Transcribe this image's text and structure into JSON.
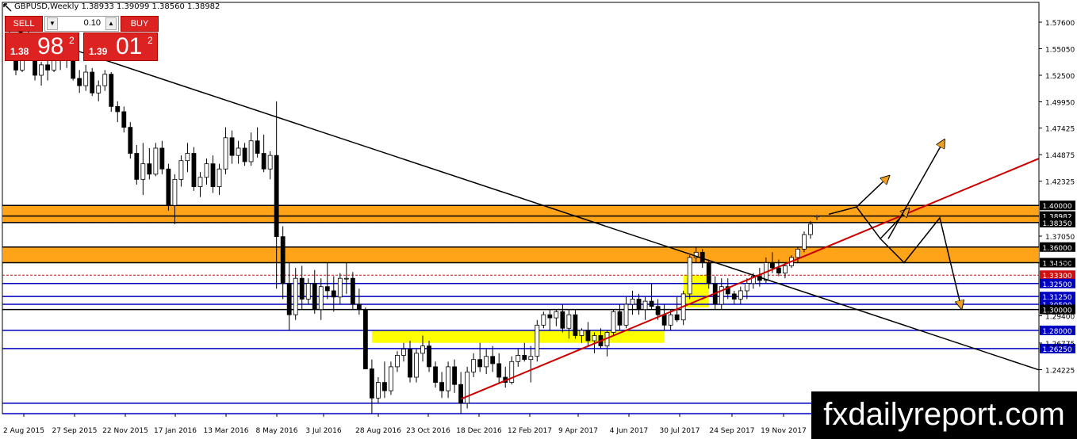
{
  "header": {
    "title": "GBPUSD,Weekly  1.38933 1.39099 1.38560 1.38982"
  },
  "trade_panel": {
    "sell_label": "SELL",
    "buy_label": "BUY",
    "lot_value": "0.10",
    "sell_price_small": "1.38",
    "sell_price_big": "98",
    "sell_price_sup": "2",
    "buy_price_small": "1.39",
    "buy_price_big": "01",
    "buy_price_sup": "2"
  },
  "watermark": "fxdailyreport.com",
  "chart_data": {
    "type": "candlestick",
    "symbol": "GBPUSD",
    "timeframe": "Weekly",
    "ylim": [
      1.2,
      1.595
    ],
    "price_axis_ticks": [
      "1.57600",
      "1.55050",
      "1.52500",
      "1.49950",
      "1.47425",
      "1.44875",
      "1.42325",
      "1.37050",
      "1.34500",
      "1.29400",
      "1.26775",
      "1.24225"
    ],
    "x_tick_labels": [
      "2 Aug 2015",
      "27 Sep 2015",
      "22 Nov 2015",
      "17 Jan 2016",
      "13 Mar 2016",
      "8 May 2016",
      "3 Jul 2016",
      "28 Aug 2016",
      "23 Oct 2016",
      "18 Dec 2016",
      "12 Feb 2017",
      "9 Apr 2017",
      "4 Jun 2017",
      "30 Jul 2017",
      "24 Sep 2017",
      "19 Nov 2017"
    ],
    "horizontal_levels": [
      {
        "value": 1.4,
        "label": "1.40000",
        "color": "#000000"
      },
      {
        "value": 1.3898,
        "label": "1.38982",
        "color": "#000000"
      },
      {
        "value": 1.3835,
        "label": "1.38350",
        "color": "#000000"
      },
      {
        "value": 1.36,
        "label": "1.36000",
        "color": "#000000"
      },
      {
        "value": 1.345,
        "label": "1.34500",
        "color": "#000000"
      },
      {
        "value": 1.333,
        "label": "1.33300",
        "color": "#d01010"
      },
      {
        "value": 1.325,
        "label": "1.32500",
        "color": "#0000c0"
      },
      {
        "value": 1.3125,
        "label": "1.31250",
        "color": "#0000c0"
      },
      {
        "value": 1.305,
        "label": "1.30500",
        "color": "#0000c0"
      },
      {
        "value": 1.3,
        "label": "1.30000",
        "color": "#000000"
      },
      {
        "value": 1.28,
        "label": "1.28000",
        "color": "#0000c0"
      },
      {
        "value": 1.2625,
        "label": "1.26250",
        "color": "#0000c0"
      },
      {
        "value": 1.21,
        "label": "",
        "color": "#0000c0"
      },
      {
        "value": 1.2,
        "label": "",
        "color": "#0000c0"
      }
    ],
    "zones": [
      {
        "from": 1.3835,
        "to": 1.4,
        "color": "#ff9900"
      },
      {
        "from": 1.345,
        "to": 1.36,
        "color": "#ff9900"
      }
    ],
    "candles": [
      [
        1.56,
        1.57,
        1.545,
        1.552
      ],
      [
        1.552,
        1.558,
        1.525,
        1.53
      ],
      [
        1.53,
        1.56,
        1.528,
        1.555
      ],
      [
        1.555,
        1.57,
        1.548,
        1.56
      ],
      [
        1.56,
        1.565,
        1.52,
        1.525
      ],
      [
        1.525,
        1.538,
        1.515,
        1.535
      ],
      [
        1.535,
        1.545,
        1.52,
        1.53
      ],
      [
        1.53,
        1.552,
        1.528,
        1.55
      ],
      [
        1.55,
        1.555,
        1.53,
        1.54
      ],
      [
        1.54,
        1.558,
        1.532,
        1.555
      ],
      [
        1.555,
        1.558,
        1.52,
        1.522
      ],
      [
        1.522,
        1.53,
        1.508,
        1.515
      ],
      [
        1.515,
        1.535,
        1.51,
        1.528
      ],
      [
        1.528,
        1.532,
        1.505,
        1.508
      ],
      [
        1.508,
        1.52,
        1.5,
        1.515
      ],
      [
        1.515,
        1.53,
        1.51,
        1.526
      ],
      [
        1.526,
        1.528,
        1.49,
        1.495
      ],
      [
        1.495,
        1.5,
        1.48,
        1.49
      ],
      [
        1.49,
        1.495,
        1.47,
        1.475
      ],
      [
        1.475,
        1.48,
        1.445,
        1.45
      ],
      [
        1.45,
        1.458,
        1.42,
        1.425
      ],
      [
        1.425,
        1.46,
        1.41,
        1.44
      ],
      [
        1.44,
        1.455,
        1.425,
        1.43
      ],
      [
        1.43,
        1.46,
        1.428,
        1.455
      ],
      [
        1.455,
        1.462,
        1.43,
        1.435
      ],
      [
        1.435,
        1.44,
        1.395,
        1.4
      ],
      [
        1.4,
        1.43,
        1.382,
        1.425
      ],
      [
        1.425,
        1.448,
        1.418,
        1.443
      ],
      [
        1.443,
        1.46,
        1.432,
        1.45
      ],
      [
        1.45,
        1.456,
        1.414,
        1.418
      ],
      [
        1.418,
        1.432,
        1.408,
        1.427
      ],
      [
        1.427,
        1.445,
        1.42,
        1.44
      ],
      [
        1.44,
        1.448,
        1.412,
        1.418
      ],
      [
        1.418,
        1.44,
        1.41,
        1.435
      ],
      [
        1.435,
        1.475,
        1.43,
        1.465
      ],
      [
        1.465,
        1.472,
        1.44,
        1.448
      ],
      [
        1.448,
        1.462,
        1.44,
        1.455
      ],
      [
        1.455,
        1.46,
        1.438,
        1.442
      ],
      [
        1.442,
        1.47,
        1.438,
        1.462
      ],
      [
        1.462,
        1.475,
        1.446,
        1.45
      ],
      [
        1.45,
        1.468,
        1.432,
        1.435
      ],
      [
        1.435,
        1.452,
        1.425,
        1.448
      ],
      [
        1.448,
        1.5,
        1.32,
        1.37
      ],
      [
        1.37,
        1.38,
        1.31,
        1.325
      ],
      [
        1.325,
        1.345,
        1.28,
        1.295
      ],
      [
        1.295,
        1.34,
        1.29,
        1.33
      ],
      [
        1.33,
        1.342,
        1.3,
        1.31
      ],
      [
        1.31,
        1.33,
        1.305,
        1.325
      ],
      [
        1.325,
        1.338,
        1.296,
        1.3
      ],
      [
        1.3,
        1.33,
        1.29,
        1.322
      ],
      [
        1.322,
        1.345,
        1.31,
        1.318
      ],
      [
        1.318,
        1.332,
        1.298,
        1.312
      ],
      [
        1.312,
        1.335,
        1.305,
        1.33
      ],
      [
        1.33,
        1.345,
        1.315,
        1.33
      ],
      [
        1.33,
        1.336,
        1.3,
        1.305
      ],
      [
        1.305,
        1.32,
        1.295,
        1.3
      ],
      [
        1.3,
        1.302,
        1.265,
        1.243
      ],
      [
        1.243,
        1.252,
        1.2,
        1.215
      ],
      [
        1.215,
        1.235,
        1.21,
        1.23
      ],
      [
        1.23,
        1.25,
        1.215,
        1.222
      ],
      [
        1.222,
        1.25,
        1.218,
        1.245
      ],
      [
        1.245,
        1.26,
        1.24,
        1.256
      ],
      [
        1.256,
        1.268,
        1.25,
        1.262
      ],
      [
        1.262,
        1.27,
        1.23,
        1.235
      ],
      [
        1.235,
        1.262,
        1.23,
        1.258
      ],
      [
        1.258,
        1.275,
        1.25,
        1.265
      ],
      [
        1.265,
        1.27,
        1.24,
        1.245
      ],
      [
        1.245,
        1.25,
        1.225,
        1.23
      ],
      [
        1.23,
        1.24,
        1.215,
        1.222
      ],
      [
        1.222,
        1.25,
        1.215,
        1.245
      ],
      [
        1.245,
        1.252,
        1.22,
        1.228
      ],
      [
        1.228,
        1.24,
        1.2,
        1.21
      ],
      [
        1.21,
        1.245,
        1.205,
        1.24
      ],
      [
        1.24,
        1.258,
        1.235,
        1.252
      ],
      [
        1.252,
        1.268,
        1.24,
        1.245
      ],
      [
        1.245,
        1.262,
        1.238,
        1.255
      ],
      [
        1.255,
        1.265,
        1.24,
        1.248
      ],
      [
        1.248,
        1.258,
        1.23,
        1.235
      ],
      [
        1.235,
        1.245,
        1.225,
        1.23
      ],
      [
        1.23,
        1.255,
        1.228,
        1.25
      ],
      [
        1.25,
        1.262,
        1.245,
        1.256
      ],
      [
        1.256,
        1.268,
        1.25,
        1.252
      ],
      [
        1.252,
        1.265,
        1.23,
        1.255
      ],
      [
        1.255,
        1.29,
        1.25,
        1.285
      ],
      [
        1.285,
        1.298,
        1.282,
        1.295
      ],
      [
        1.295,
        1.3,
        1.28,
        1.292
      ],
      [
        1.292,
        1.3,
        1.284,
        1.298
      ],
      [
        1.298,
        1.305,
        1.278,
        1.282
      ],
      [
        1.282,
        1.3,
        1.272,
        1.295
      ],
      [
        1.295,
        1.3,
        1.272,
        1.275
      ],
      [
        1.275,
        1.282,
        1.268,
        1.28
      ],
      [
        1.28,
        1.288,
        1.265,
        1.27
      ],
      [
        1.27,
        1.278,
        1.258,
        1.275
      ],
      [
        1.275,
        1.282,
        1.262,
        1.265
      ],
      [
        1.265,
        1.28,
        1.255,
        1.278
      ],
      [
        1.278,
        1.3,
        1.275,
        1.298
      ],
      [
        1.298,
        1.305,
        1.28,
        1.285
      ],
      [
        1.285,
        1.312,
        1.282,
        1.305
      ],
      [
        1.305,
        1.318,
        1.295,
        1.31
      ],
      [
        1.31,
        1.315,
        1.295,
        1.3
      ],
      [
        1.3,
        1.312,
        1.29,
        1.308
      ],
      [
        1.308,
        1.325,
        1.3,
        1.303
      ],
      [
        1.303,
        1.31,
        1.29,
        1.295
      ],
      [
        1.295,
        1.305,
        1.28,
        1.285
      ],
      [
        1.285,
        1.3,
        1.28,
        1.295
      ],
      [
        1.295,
        1.312,
        1.288,
        1.29
      ],
      [
        1.29,
        1.318,
        1.285,
        1.315
      ],
      [
        1.315,
        1.352,
        1.31,
        1.35
      ],
      [
        1.35,
        1.36,
        1.345,
        1.355
      ],
      [
        1.355,
        1.358,
        1.34,
        1.345
      ],
      [
        1.345,
        1.348,
        1.32,
        1.325
      ],
      [
        1.325,
        1.332,
        1.3,
        1.305
      ],
      [
        1.305,
        1.33,
        1.3,
        1.322
      ],
      [
        1.322,
        1.33,
        1.31,
        1.315
      ],
      [
        1.315,
        1.318,
        1.305,
        1.31
      ],
      [
        1.31,
        1.322,
        1.305,
        1.318
      ],
      [
        1.318,
        1.33,
        1.31,
        1.325
      ],
      [
        1.325,
        1.335,
        1.32,
        1.332
      ],
      [
        1.332,
        1.34,
        1.322,
        1.328
      ],
      [
        1.328,
        1.35,
        1.325,
        1.345
      ],
      [
        1.345,
        1.355,
        1.335,
        1.34
      ],
      [
        1.34,
        1.348,
        1.332,
        1.335
      ],
      [
        1.335,
        1.345,
        1.33,
        1.342
      ],
      [
        1.342,
        1.352,
        1.34,
        1.35
      ],
      [
        1.35,
        1.36,
        1.345,
        1.358
      ],
      [
        1.358,
        1.375,
        1.355,
        1.372
      ],
      [
        1.372,
        1.385,
        1.368,
        1.382
      ],
      [
        1.389,
        1.391,
        1.386,
        1.39
      ]
    ],
    "trendlines": [
      {
        "name": "",
        "color": "#000000",
        "from": [
          0,
          1.57
        ],
        "to": [
          1,
          1.242
        ]
      },
      {
        "name": "",
        "color": "#cc0000",
        "from": [
          0,
          1.214
        ],
        "to": [
          1,
          1.445
        ]
      }
    ],
    "highlight_boxes": [
      {
        "from": 1.268,
        "to": 1.28,
        "color": "#ffff00"
      },
      {
        "from": 1.302,
        "to": 1.333,
        "color": "#ffff00"
      }
    ],
    "projection_arrows": 6
  }
}
